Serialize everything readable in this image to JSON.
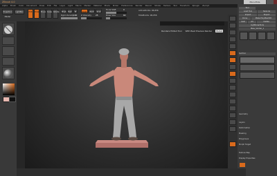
{
  "menu": {
    "items": [
      "Alpha",
      "Brush",
      "Color",
      "Document",
      "Draw",
      "Edit",
      "File",
      "Layer",
      "Light",
      "Macro",
      "Marker",
      "Material",
      "Movie",
      "Picker",
      "Preferences",
      "Render",
      "Stencil",
      "Stroke",
      "Texture",
      "Tool",
      "Transform",
      "Zplugin",
      "Zscript"
    ]
  },
  "toolbar": {
    "projection_master": "Projection Master",
    "lightbox": "LightBox",
    "edit": "Edit",
    "draw": "Draw",
    "move": "Move",
    "scale": "Scale",
    "rotate": "Rotate",
    "mrgb": "Mrgb",
    "rgb": "Rgb",
    "m": "M",
    "zadd": "Zadd",
    "zsub": "Zsub",
    "zcut": "Zcut",
    "focal_shift_label": "Focal Shift",
    "focal_shift_value": "0",
    "draw_size_label": "Draw Size",
    "draw_size_value": "64",
    "z_intensity_label": "Z Intensity",
    "z_intensity_value": "25",
    "active_points": "ActivePoints: 96,656",
    "total_points": "TotalPoints: 96,656",
    "rgb_intensity_label": "Rgb Intensity",
    "rgb_intensity_value": "100"
  },
  "viewport": {
    "render_header": "Renders Edited Tool",
    "best_preview": "With Best Preview Render",
    "bullet": "Bullet"
  },
  "tray": {
    "title": "Tool",
    "load_tool": "Load Tool",
    "save_as": "Save As",
    "import": "Import",
    "export": "Export",
    "clone": "Clone",
    "make_polymesh": "Make PolyMesh3D",
    "goz": "GoZ",
    "all": "All",
    "visible": "Visible",
    "lightbox_tools": "Lightbox▸Tools",
    "tool_name": "Male_Soldier_1",
    "subtool": "SubTool",
    "geometry": "Geometry",
    "layers": "Layers",
    "deformation": "Deformation",
    "masking": "Masking",
    "polygroups": "Polygroups",
    "morph_target": "Morph Target",
    "texture_map": "Texture Map",
    "display_properties": "Display Properties"
  },
  "title_bar": {
    "app_title": "ZBrush 4.0",
    "user_label": "MenuHide"
  },
  "colors": {
    "accent_orange": "#d96a1c",
    "background": "#2b2b2b",
    "skin": "#c9887a",
    "pants": "#a8a8a8",
    "base": "#b0706a"
  }
}
